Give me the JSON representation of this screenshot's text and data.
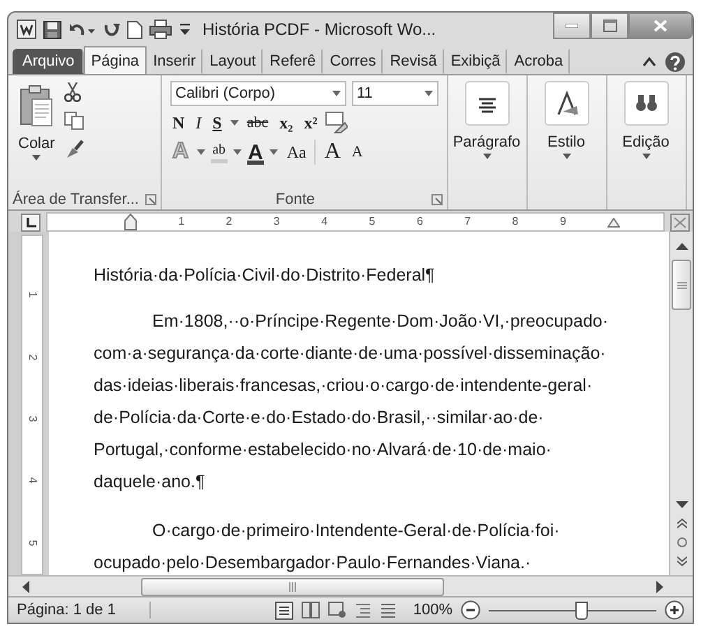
{
  "window": {
    "title": "História PCDF - Microsoft Wo..."
  },
  "tabs": [
    {
      "label": "Arquivo",
      "kind": "file",
      "selected": false
    },
    {
      "label": "Página",
      "kind": "tab",
      "selected": true
    },
    {
      "label": "Inserir",
      "kind": "tab",
      "selected": false
    },
    {
      "label": "Layout",
      "kind": "tab",
      "selected": false
    },
    {
      "label": "Referê",
      "kind": "tab",
      "selected": false
    },
    {
      "label": "Corres",
      "kind": "tab",
      "selected": false
    },
    {
      "label": "Revisã",
      "kind": "tab",
      "selected": false
    },
    {
      "label": "Exibiçã",
      "kind": "tab",
      "selected": false
    },
    {
      "label": "Acroba",
      "kind": "tab",
      "selected": false
    }
  ],
  "ribbon": {
    "clipboard": {
      "paste": "Colar",
      "group_label": "Área de Transfer..."
    },
    "font": {
      "font_name": "Calibri (Corpo)",
      "font_size": "11",
      "bold": "N",
      "italic": "I",
      "underline": "S",
      "strikethrough": "abc",
      "subscript": "x₂",
      "superscript": "x²",
      "text_effects": "A",
      "highlight": "ab",
      "font_color": "A",
      "change_case": "Aa",
      "grow": "A",
      "shrink": "A",
      "group_label": "Fonte"
    },
    "large_buttons": [
      {
        "label": "Parágrafo",
        "kind": "paragraph"
      },
      {
        "label": "Estilo",
        "kind": "styles"
      },
      {
        "label": "Edição",
        "kind": "find"
      }
    ]
  },
  "ruler": {
    "numbers": [
      "1",
      "2",
      "3",
      "4",
      "5",
      "6",
      "7",
      "8",
      "9"
    ]
  },
  "vertical_ruler": {
    "numbers": [
      "1",
      "2",
      "3",
      "4",
      "5"
    ]
  },
  "document": {
    "paragraphs": [
      {
        "kind": "heading",
        "lines": [
          "História·da·Polícia·Civil·do·Distrito·Federal¶"
        ]
      },
      {
        "kind": "body",
        "lines": [
          "Em·1808,··o·Príncipe·Regente·Dom·João·VI,·preocupado·",
          "com·a·segurança·da·corte·diante·de·uma·possível·disseminação·",
          "das·ideias·liberais·francesas,·criou·o·cargo·de·intendente-geral·",
          "de·Polícia·da·Corte·e·do·Estado·do·Brasil,··similar·ao·de·",
          "Portugal,·conforme·estabelecido·no·Alvará·de·10·de·maio·",
          "daquele·ano.¶"
        ]
      },
      {
        "kind": "body",
        "lines": [
          "O·cargo·de·primeiro·Intendente-Geral·de·Polícia·foi·",
          "ocupado·pelo·Desembargador·Paulo·Fernandes·Viana.·"
        ]
      }
    ]
  },
  "status_bar": {
    "page": "Página: 1 de 1",
    "zoom": "100%",
    "zoom_slider": {
      "level": 0.55
    }
  }
}
